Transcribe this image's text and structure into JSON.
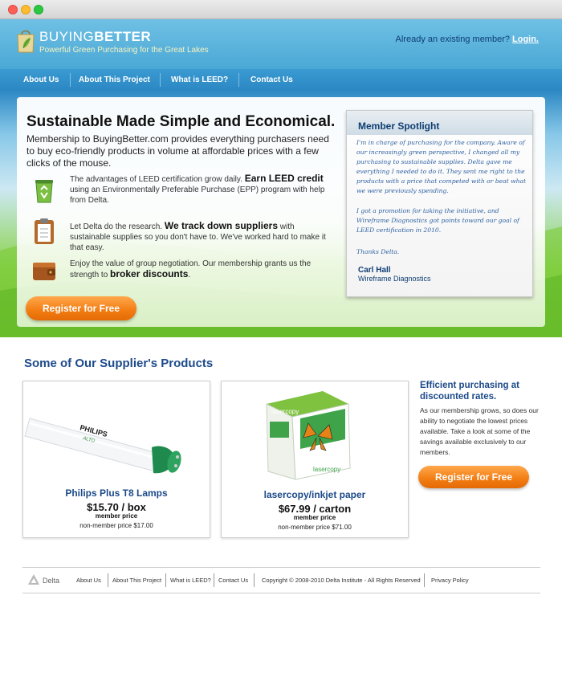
{
  "header": {
    "logo_part1": "BUYING",
    "logo_part2": "BETTER",
    "tagline": "Powerful Green Purchasing for the Great Lakes",
    "member_prompt": "Already an existing member?",
    "login_label": "Login."
  },
  "nav": {
    "items": [
      "About Us",
      "About This Project",
      "What is LEED?",
      "Contact Us"
    ]
  },
  "hero": {
    "title": "Sustainable Made Simple and Economical.",
    "intro": "Membership to BuyingBetter.com provides everything purchasers need to buy eco-friendly products in volume at affordable prices with a few clicks of the mouse.",
    "features": [
      {
        "icon": "recycle-bin-icon",
        "pre": "The advantages of LEED certification grow daily.",
        "em": "Earn LEED credit",
        "post": "using an Environmentally Preferable Purchase (EPP) program with help from Delta."
      },
      {
        "icon": "clipboard-icon",
        "pre": "Let Delta do the research.",
        "em": "We track down suppliers",
        "post": "with sustainable supplies so you don't have to. We've worked hard to make it that easy."
      },
      {
        "icon": "wallet-icon",
        "pre": "Enjoy the value of group negotiation. Our membership grants us the strength to",
        "em": "broker discounts",
        "post": "."
      }
    ],
    "cta_label": "Register for Free"
  },
  "spotlight": {
    "title": "Member Spotlight",
    "quote_p1": "I'm in charge of purchasing for the company. Aware of our increasingly green perspective, I changed all my purchasing to sustainable supplies. Delta gave me everything I needed to do it. They sent me right to the products with a price that competed with or beat what we were previously spending.",
    "quote_p2": "I got a promotion for taking the initiative, and Wireframe Diagnostics got points toward our goal of LEED certification in 2010.",
    "quote_p3": "Thanks Delta.",
    "name": "Carl Hall",
    "company": "Wireframe Diagnostics"
  },
  "products": {
    "section_title": "Some of Our Supplier's Products",
    "items": [
      {
        "name": "Philips Plus T8 Lamps",
        "price": "$15.70 / box",
        "member_label": "member price",
        "nonmember": "non-member price $17.00",
        "brand": "PHILIPS",
        "brand_sub": "ALTO",
        "image": "fluorescent-lamp"
      },
      {
        "name": "lasercopy/inkjet paper",
        "price": "$67.99 / carton",
        "member_label": "member price",
        "nonmember": "non-member price $71.00",
        "brand": "lasercopy",
        "image": "paper-box"
      }
    ],
    "side_title": "Efficient purchasing at discounted rates.",
    "side_text": "As our membership grows, so does our ability to negotiate the lowest prices available. Take a look at some of the savings available exclusively to our members.",
    "side_cta": "Register for Free"
  },
  "footer": {
    "brand": "Delta",
    "links": [
      "About Us",
      "About This Project",
      "What is LEED?",
      "Contact Us"
    ],
    "copyright": "Copyright © 2008-2010 Delta Institute - All Rights Reserved",
    "privacy": "Privacy Policy"
  },
  "colors": {
    "header_blue": "#4aa8d6",
    "nav_blue": "#2c88c4",
    "navy_text": "#1c4a8a",
    "orange_button": "#f27c12",
    "hero_green": "#6fc22c"
  }
}
